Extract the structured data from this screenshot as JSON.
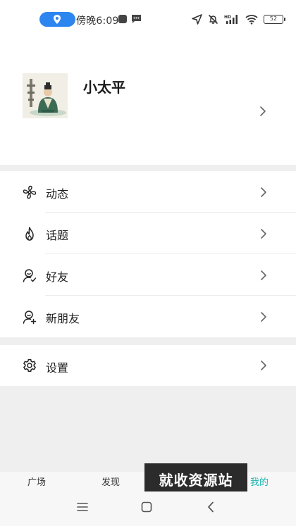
{
  "status_bar": {
    "time": "傍晚6:09",
    "battery": "52",
    "icons": [
      "location-icon",
      "app-square-icon",
      "chat-bubble-icon",
      "navigation-arrow-icon",
      "mute-bell-icon",
      "hd-signal-icon",
      "wifi-icon",
      "battery-icon"
    ]
  },
  "profile": {
    "username": "小太平",
    "avatar_icon": "avatar-image"
  },
  "menu": {
    "items": [
      {
        "label": "动态",
        "icon": "pinwheel-icon"
      },
      {
        "label": "话题",
        "icon": "flame-icon"
      },
      {
        "label": "好友",
        "icon": "friend-check-icon"
      },
      {
        "label": "新朋友",
        "icon": "friend-add-icon"
      }
    ]
  },
  "settings": {
    "label": "设置",
    "icon": "gear-icon"
  },
  "tabbar": {
    "tabs": [
      {
        "label": "广场",
        "active": false
      },
      {
        "label": "发现",
        "active": false
      },
      {
        "label": "我的",
        "active": true
      }
    ],
    "watermark": "就收资源站"
  },
  "colors": {
    "accent": "#1fb5b0",
    "location_pill": "#2d86f0",
    "background": "#efefef"
  }
}
